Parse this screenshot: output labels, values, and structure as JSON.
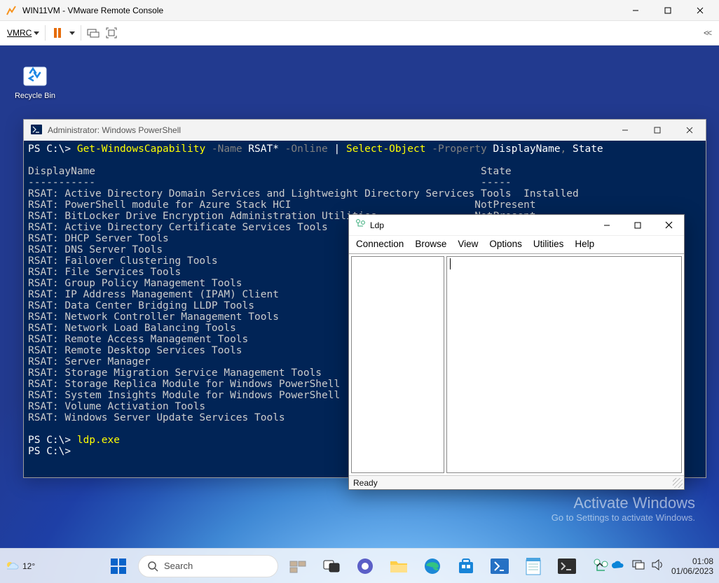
{
  "vmware": {
    "title": "WIN11VM - VMware Remote Console",
    "menu_label": "VMRC"
  },
  "desktop": {
    "recycle_label": "Recycle Bin"
  },
  "powershell": {
    "title": "Administrator: Windows PowerShell",
    "prompt1_prefix": "PS C:\\> ",
    "cmd_get": "Get-WindowsCapability",
    "arg_name": " -Name ",
    "val_rsat": "RSAT*",
    "arg_online": " -Online",
    "pipe": " | ",
    "cmd_select": "Select-Object",
    "arg_prop": " -Property ",
    "val_dn": "DisplayName",
    "comma": ", ",
    "val_state": "State",
    "header": "DisplayName                                                               State\n-----------                                                               -----\nRSAT: Active Directory Domain Services and Lightweight Directory Services Tools  Installed\nRSAT: PowerShell module for Azure Stack HCI                              NotPresent\nRSAT: BitLocker Drive Encryption Administration Utilities                NotPresent\nRSAT: Active Directory Certificate Services Tools\nRSAT: DHCP Server Tools\nRSAT: DNS Server Tools\nRSAT: Failover Clustering Tools\nRSAT: File Services Tools\nRSAT: Group Policy Management Tools\nRSAT: IP Address Management (IPAM) Client\nRSAT: Data Center Bridging LLDP Tools\nRSAT: Network Controller Management Tools\nRSAT: Network Load Balancing Tools\nRSAT: Remote Access Management Tools\nRSAT: Remote Desktop Services Tools\nRSAT: Server Manager\nRSAT: Storage Migration Service Management Tools\nRSAT: Storage Replica Module for Windows PowerShell\nRSAT: System Insights Module for Windows PowerShell\nRSAT: Volume Activation Tools\nRSAT: Windows Server Update Services Tools\n\n",
    "prompt2_prefix": "PS C:\\> ",
    "cmd_ldp": "ldp.exe",
    "prompt3": "PS C:\\>"
  },
  "ldp": {
    "title": "Ldp",
    "menu": {
      "connection": "Connection",
      "browse": "Browse",
      "view": "View",
      "options": "Options",
      "utilities": "Utilities",
      "help": "Help"
    },
    "status": "Ready"
  },
  "activate": {
    "title": "Activate Windows",
    "sub": "Go to Settings to activate Windows."
  },
  "taskbar": {
    "temp": "12°",
    "search_placeholder": "Search",
    "time": "01:08",
    "date": "01/06/2023"
  }
}
